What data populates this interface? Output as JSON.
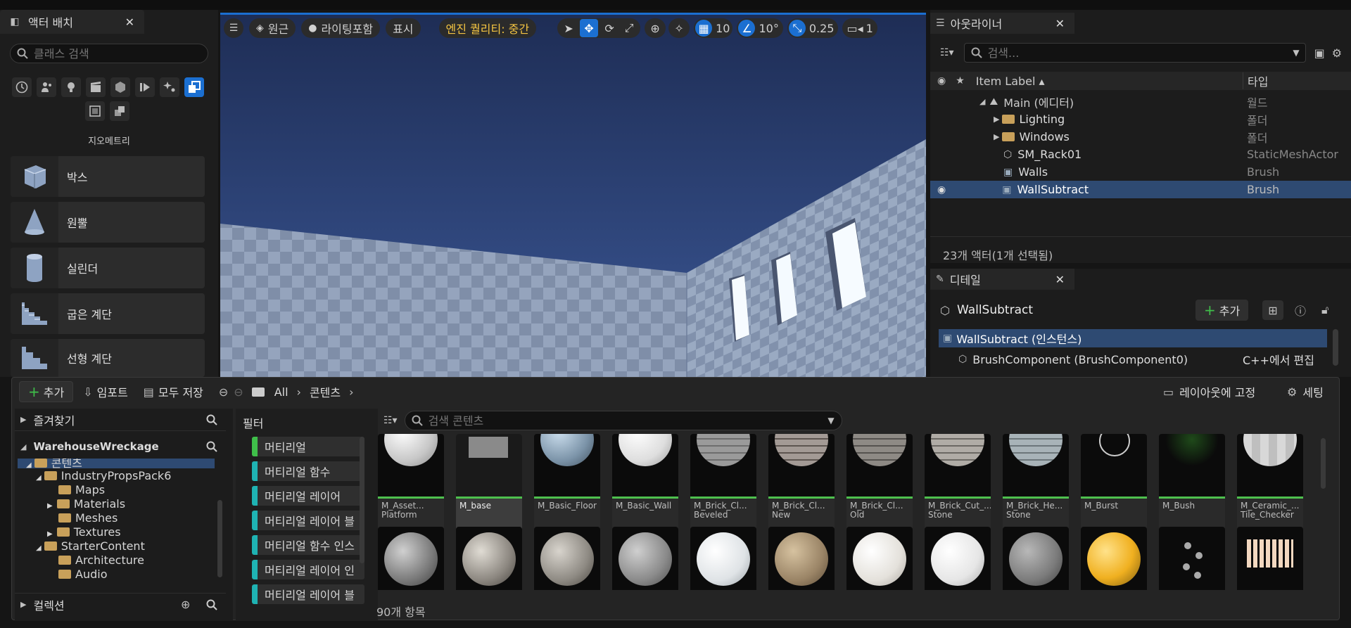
{
  "left_panel": {
    "tab_title": "액터 배치",
    "search_placeholder": "클래스 검색",
    "category_label": "지오메트리",
    "category_icons": [
      "clock-icon",
      "person-light-icon",
      "bulb-icon",
      "film-icon",
      "cube-icon",
      "play-icon",
      "sparkle-icon",
      "geometry-icon",
      "panel-icon",
      "layers-icon"
    ],
    "shapes": [
      {
        "label": "박스",
        "icon": "box-icon"
      },
      {
        "label": "원뿔",
        "icon": "cone-icon"
      },
      {
        "label": "실린더",
        "icon": "cylinder-icon"
      },
      {
        "label": "굽은 계단",
        "icon": "curved-stairs-icon"
      },
      {
        "label": "선형 계단",
        "icon": "linear-stairs-icon"
      }
    ]
  },
  "viewport": {
    "perspective_label": "원근",
    "lighting_label": "라이팅포함",
    "show_label": "표시",
    "quality_label": "엔진 퀄리티: 중간",
    "grid_value": "10",
    "angle_value": "10°",
    "scale_value": "0.25",
    "camera_value": "1",
    "accent": "#1b6fd1",
    "quality_color": "#f5c542"
  },
  "outliner": {
    "tab_title": "아웃라이너",
    "search_placeholder": "검색...",
    "col_label": "Item Label ▴",
    "col_type": "타입",
    "rows": [
      {
        "label": "Main (에디터)",
        "type": "월드",
        "icon": "world-icon"
      },
      {
        "label": "Lighting",
        "type": "폴더",
        "icon": "folder-icon"
      },
      {
        "label": "Windows",
        "type": "폴더",
        "icon": "folder-icon"
      },
      {
        "label": "SM_Rack01",
        "type": "StaticMeshActor",
        "icon": "mesh-icon"
      },
      {
        "label": "Walls",
        "type": "Brush",
        "icon": "brush-icon"
      },
      {
        "label": "WallSubtract",
        "type": "Brush",
        "icon": "brush-icon"
      }
    ],
    "status": "23개 액터(1개 선택됨)"
  },
  "details": {
    "tab_title": "디테일",
    "object_name": "WallSubtract",
    "add_label": "추가",
    "instance_label": "WallSubtract (인스턴스)",
    "component_label": "BrushComponent (BrushComponent0)",
    "component_action": "C++에서 편집"
  },
  "drawer": {
    "add_label": "추가",
    "import_label": "임포트",
    "save_all_label": "모두 저장",
    "crumb_all": "All",
    "crumb_content": "콘텐츠",
    "dock_label": "레이아웃에 고정",
    "settings_label": "세팅",
    "favorites_label": "즐겨찾기",
    "project_label": "WarehouseWreckage",
    "tree": [
      {
        "label": "콘텐츠"
      },
      {
        "label": "IndustryPropsPack6"
      },
      {
        "label": "Maps"
      },
      {
        "label": "Materials"
      },
      {
        "label": "Meshes"
      },
      {
        "label": "Textures"
      },
      {
        "label": "StarterContent"
      },
      {
        "label": "Architecture"
      },
      {
        "label": "Audio"
      }
    ],
    "collections_label": "컬렉션",
    "filter_title": "필터",
    "filters": [
      {
        "label": "머티리얼",
        "color": "#3fbf4a"
      },
      {
        "label": "머티리얼 함수",
        "color": "#1fb3b3"
      },
      {
        "label": "머티리얼 레이어",
        "color": "#1fb3b3"
      },
      {
        "label": "머티리얼 레이어 블",
        "color": "#1fb3b3"
      },
      {
        "label": "머티리얼 함수 인스",
        "color": "#1fb3b3"
      },
      {
        "label": "머티리얼 레이어 인",
        "color": "#1fb3b3"
      },
      {
        "label": "머티리얼 레이어 블",
        "color": "#1fb3b3"
      }
    ],
    "search_placeholder": "검색 콘텐츠",
    "assets": [
      {
        "name": "M_Asset... Platform",
        "type": "머티리얼"
      },
      {
        "name": "M_base",
        "type": "머티리얼"
      },
      {
        "name": "M_Basic_Floor",
        "type": "머티리얼"
      },
      {
        "name": "M_Basic_Wall",
        "type": "머티리얼"
      },
      {
        "name": "M_Brick_Cl... Beveled",
        "type": "머티리얼"
      },
      {
        "name": "M_Brick_Cl... New",
        "type": "머티리얼"
      },
      {
        "name": "M_Brick_Cl... Old",
        "type": "머티리얼"
      },
      {
        "name": "M_Brick_Cut_... Stone",
        "type": "머티리얼"
      },
      {
        "name": "M_Brick_He... Stone",
        "type": "머티리얼"
      },
      {
        "name": "M_Burst",
        "type": "머티리얼"
      },
      {
        "name": "M_Bush",
        "type": "머티리얼"
      },
      {
        "name": "M_Ceramic_... Tile_Checker",
        "type": "머티리얼"
      }
    ],
    "item_count": "90개 항목"
  }
}
